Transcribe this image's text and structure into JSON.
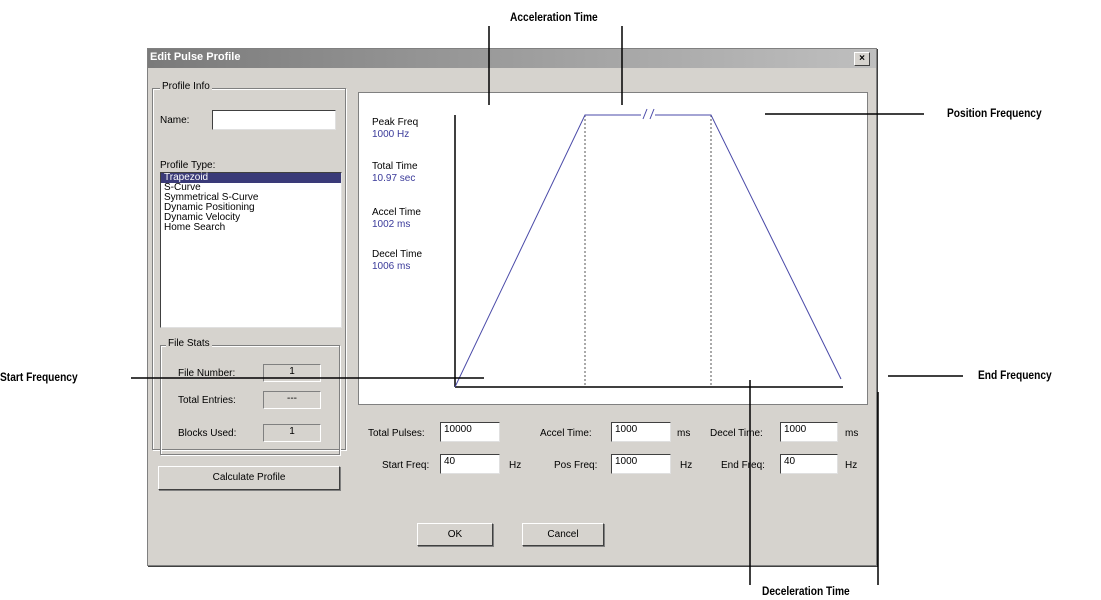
{
  "annotations": {
    "acceleration_time": "Acceleration Time",
    "position_frequency": "Position Frequency",
    "start_frequency": "Start Frequency",
    "end_frequency": "End Frequency",
    "deceleration_time": "Deceleration Time"
  },
  "dialog": {
    "title": "Edit Pulse Profile",
    "close_label": "×",
    "profile_info_label": "Profile Info",
    "name_label": "Name:",
    "name_value": "",
    "profile_type_label": "Profile Type:",
    "profile_types": [
      "Trapezoid",
      "S-Curve",
      "Symmetrical S-Curve",
      "Dynamic Positioning",
      "Dynamic Velocity",
      "Home Search"
    ],
    "selected_profile_type": "Trapezoid",
    "file_stats": {
      "label": "File Stats",
      "file_number_label": "File Number:",
      "file_number": "1",
      "total_entries_label": "Total Entries:",
      "total_entries": "---",
      "blocks_used_label": "Blocks Used:",
      "blocks_used": "1"
    },
    "calculate_button": "Calculate Profile",
    "ok_button": "OK",
    "cancel_button": "Cancel"
  },
  "chart_info": {
    "peak_freq_label": "Peak Freq",
    "peak_freq_value": "1000 Hz",
    "total_time_label": "Total Time",
    "total_time_value": "10.97 sec",
    "accel_time_label": "Accel Time",
    "accel_time_value": "1002 ms",
    "decel_time_label": "Decel Time",
    "decel_time_value": "1006 ms"
  },
  "form": {
    "total_pulses_label": "Total Pulses:",
    "total_pulses": "10000",
    "accel_time_label": "Accel Time:",
    "accel_time": "1000",
    "accel_unit": "ms",
    "decel_time_label": "Decel Time:",
    "decel_time": "1000",
    "decel_unit": "ms",
    "start_freq_label": "Start Freq:",
    "start_freq": "40",
    "start_unit": "Hz",
    "pos_freq_label": "Pos Freq:",
    "pos_freq": "1000",
    "pos_unit": "Hz",
    "end_freq_label": "End Freq:",
    "end_freq": "40",
    "end_unit": "Hz"
  },
  "colors": {
    "profile_line": "#4a4aa8",
    "selection": "#3a3a78",
    "dialog_bg": "#d6d3ce"
  }
}
